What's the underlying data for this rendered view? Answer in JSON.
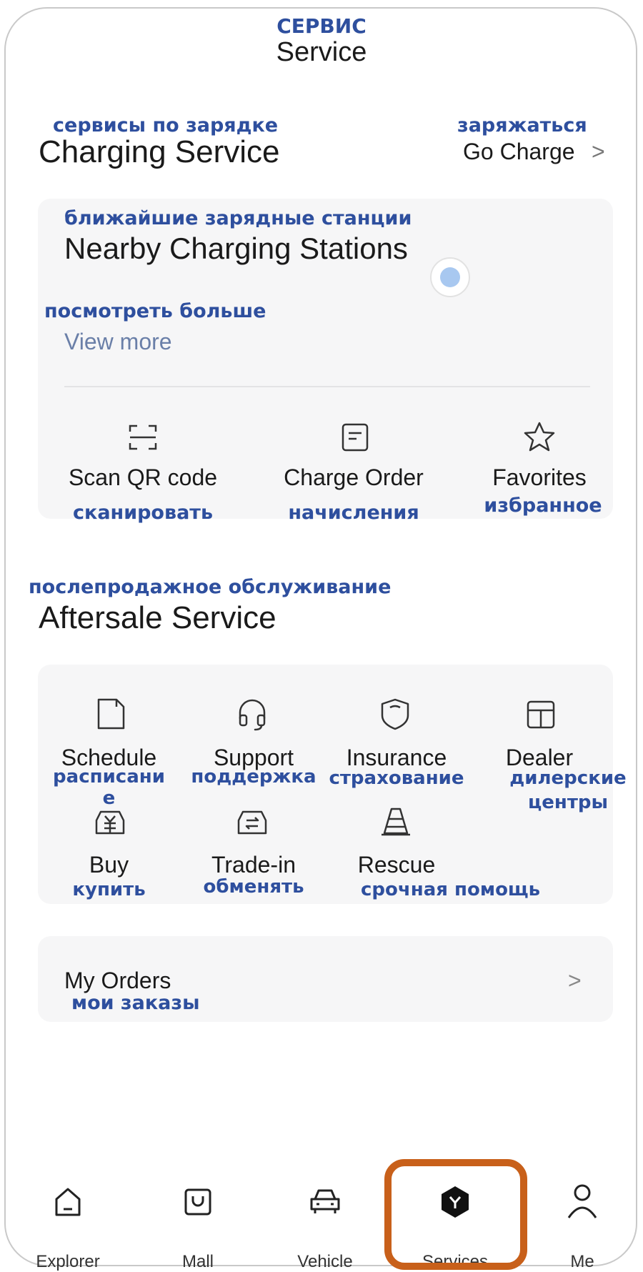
{
  "header": {
    "title_ru": "СЕРВИС",
    "title_en": "Service"
  },
  "charging": {
    "section_ru": "сервисы по зарядке",
    "section_en": "Charging Service",
    "go_charge_ru": "заряжаться",
    "go_charge_en": "Go Charge",
    "chevron": ">",
    "card": {
      "title_ru": "ближайшие зарядные станции",
      "title_en": "Nearby Charging Stations",
      "view_more_ru": "посмотреть больше",
      "view_more_en": "View more",
      "actions": [
        {
          "icon": "scan-icon",
          "label_en": "Scan QR code",
          "label_ru": "сканировать"
        },
        {
          "icon": "order-icon",
          "label_en": "Charge Order",
          "label_ru": "начисления"
        },
        {
          "icon": "star-icon",
          "label_en": "Favorites",
          "label_ru": "избранное"
        }
      ]
    }
  },
  "aftersale": {
    "section_ru": "послепродажное обслуживание",
    "section_en": "Aftersale Service",
    "items": [
      {
        "icon": "document-icon",
        "label_en": "Schedule",
        "label_ru": "расписани\nе"
      },
      {
        "icon": "headset-icon",
        "label_en": "Support",
        "label_ru": "поддержка"
      },
      {
        "icon": "shield-icon",
        "label_en": "Insurance",
        "label_ru": "страхование"
      },
      {
        "icon": "dealer-icon",
        "label_en": "Dealer",
        "label_ru": "дилерские\nцентры"
      },
      {
        "icon": "yuan-icon",
        "label_en": "Buy",
        "label_ru": "купить"
      },
      {
        "icon": "trade-in-icon",
        "label_en": "Trade-in",
        "label_ru": "обменять"
      },
      {
        "icon": "cone-icon",
        "label_en": "Rescue",
        "label_ru": "срочная помощь"
      }
    ]
  },
  "orders": {
    "label_en": "My Orders",
    "label_ru": "мои заказы",
    "chevron": ">"
  },
  "nav": {
    "items": [
      {
        "icon": "home-icon",
        "label": "Explorer"
      },
      {
        "icon": "bag-icon",
        "label": "Mall"
      },
      {
        "icon": "car-icon",
        "label": "Vehicle"
      },
      {
        "icon": "services-icon",
        "label": "Services"
      },
      {
        "icon": "person-icon",
        "label": "Me"
      }
    ],
    "active": "Services",
    "highlight_color": "#c8601a"
  },
  "colors": {
    "russian_text": "#2e4f9e",
    "card_bg": "#f6f6f7",
    "location_dot": "#a8c8f0"
  }
}
